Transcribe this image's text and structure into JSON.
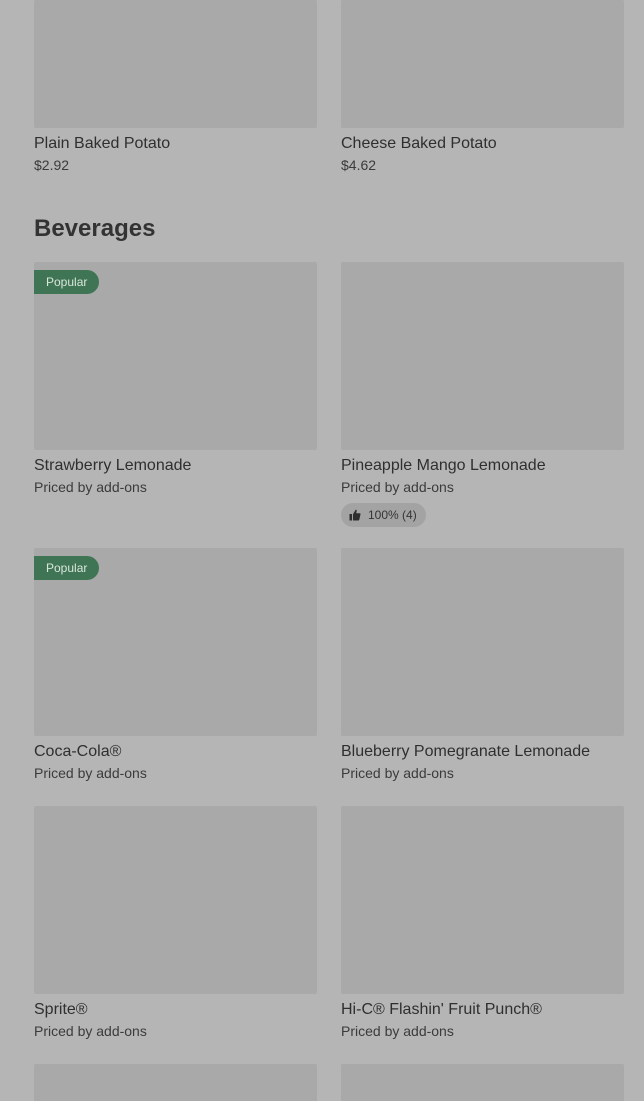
{
  "top_row": [
    {
      "name": "Plain Baked Potato",
      "price": "$2.92"
    },
    {
      "name": "Cheese Baked Potato",
      "price": "$4.62"
    }
  ],
  "beverages": {
    "title": "Beverages",
    "items": [
      {
        "name": "Strawberry Lemonade",
        "price": "Priced by add-ons",
        "badge": "Popular"
      },
      {
        "name": "Pineapple Mango Lemonade",
        "price": "Priced by add-ons",
        "rating": "100% (4)"
      },
      {
        "name": "Coca-Cola®",
        "price": "Priced by add-ons",
        "badge": "Popular"
      },
      {
        "name": "Blueberry Pomegranate Lemonade",
        "price": "Priced by add-ons"
      },
      {
        "name": "Sprite®",
        "price": "Priced by add-ons"
      },
      {
        "name": "Hi-C® Flashin' Fruit Punch®",
        "price": "Priced by add-ons"
      }
    ]
  },
  "colors": {
    "overlay_background": "#b5b5b5",
    "image_placeholder": "#a9a9a9",
    "popular_badge": "#3f7554"
  },
  "icons": {
    "rating": "thumbs-up-icon"
  }
}
